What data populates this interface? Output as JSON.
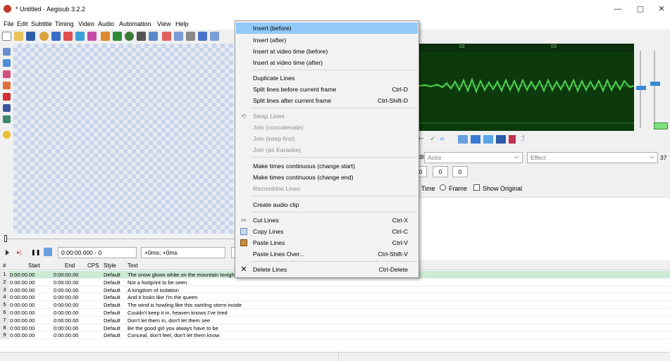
{
  "window": {
    "title": "* Untitled - Aegisub 3.2.2",
    "minimize": "—",
    "maximize": "▢",
    "close": "✕"
  },
  "menubar": [
    "File",
    "Edit",
    "Subtitle",
    "Timing",
    "Video",
    "Audio",
    "Automation",
    "View",
    "Help"
  ],
  "video_controls": {
    "time": "0:00:00.000 - 0",
    "offset": "+0ms; +0ms"
  },
  "audio": {
    "marker_02": "02",
    "marker_03": "03"
  },
  "edit": {
    "actor_placeholder": "Actor",
    "effect_placeholder": "Effect",
    "layer": "37",
    "margin_l": "0",
    "margin_r": "0",
    "margin_v": "0",
    "time_radio": "Time",
    "frame_radio": "Frame",
    "show_original": "Show Original",
    "edit_label": "dit"
  },
  "grid": {
    "headers": [
      "#",
      "Start",
      "End",
      "CPS",
      "Style",
      "Text"
    ],
    "rows": [
      {
        "n": "1",
        "start": "0:00:00.00",
        "end": "0:00:00.00",
        "style": "Default",
        "text": "The snow glows white on the mountain tonight"
      },
      {
        "n": "2",
        "start": "0:00:00.00",
        "end": "0:00:00.00",
        "style": "Default",
        "text": "Not a footprint to be seen"
      },
      {
        "n": "3",
        "start": "0:00:00.00",
        "end": "0:00:00.00",
        "style": "Default",
        "text": "A kingdom of isolation"
      },
      {
        "n": "4",
        "start": "0:00:00.00",
        "end": "0:00:00.00",
        "style": "Default",
        "text": "And it looks like I'm the queen"
      },
      {
        "n": "5",
        "start": "0:00:00.00",
        "end": "0:00:00.00",
        "style": "Default",
        "text": "The wind is howling like this swirling storm inside"
      },
      {
        "n": "6",
        "start": "0:00:00.00",
        "end": "0:00:00.00",
        "style": "Default",
        "text": "Couldn't keep it in, heaven knows I've tried"
      },
      {
        "n": "7",
        "start": "0:00:00.00",
        "end": "0:00:00.00",
        "style": "Default",
        "text": "Don't let them in, don't let them see"
      },
      {
        "n": "8",
        "start": "0:00:00.00",
        "end": "0:00:00.00",
        "style": "Default",
        "text": "Be the good girl you always have to be"
      },
      {
        "n": "9",
        "start": "0:00:00.00",
        "end": "0:00:00.00",
        "style": "Default",
        "text": "Conceal, don't feel, don't let them know"
      }
    ]
  },
  "context_menu": {
    "insert_before": "Insert (before)",
    "insert_after": "Insert (after)",
    "insert_video_before": "Insert at video time (before)",
    "insert_video_after": "Insert at video time (after)",
    "duplicate": "Duplicate Lines",
    "split_before": "Split lines before current frame",
    "split_before_sc": "Ctrl-D",
    "split_after": "Split lines after current frame",
    "split_after_sc": "Ctrl-Shift-D",
    "swap": "Swap Lines",
    "join_concat": "Join (concatenate)",
    "join_keep": "Join (keep first)",
    "join_karaoke": "Join (as Karaoke)",
    "continuous_start": "Make times continuous (change start)",
    "continuous_end": "Make times continuous (change end)",
    "recombine": "Recombine Lines",
    "audio_clip": "Create audio clip",
    "cut": "Cut Lines",
    "cut_sc": "Ctrl-X",
    "copy": "Copy Lines",
    "copy_sc": "Ctrl-C",
    "paste": "Paste Lines",
    "paste_sc": "Ctrl-V",
    "paste_over": "Paste Lines Over...",
    "paste_over_sc": "Ctrl-Shift-V",
    "delete": "Delete Lines",
    "delete_sc": "Ctrl-Delete"
  },
  "colors": {
    "menu_highlight": "#91c9f7",
    "active_row": "#ccebd4",
    "waveform": "#4fd24f",
    "audio_bg": "#0d3a0d"
  }
}
